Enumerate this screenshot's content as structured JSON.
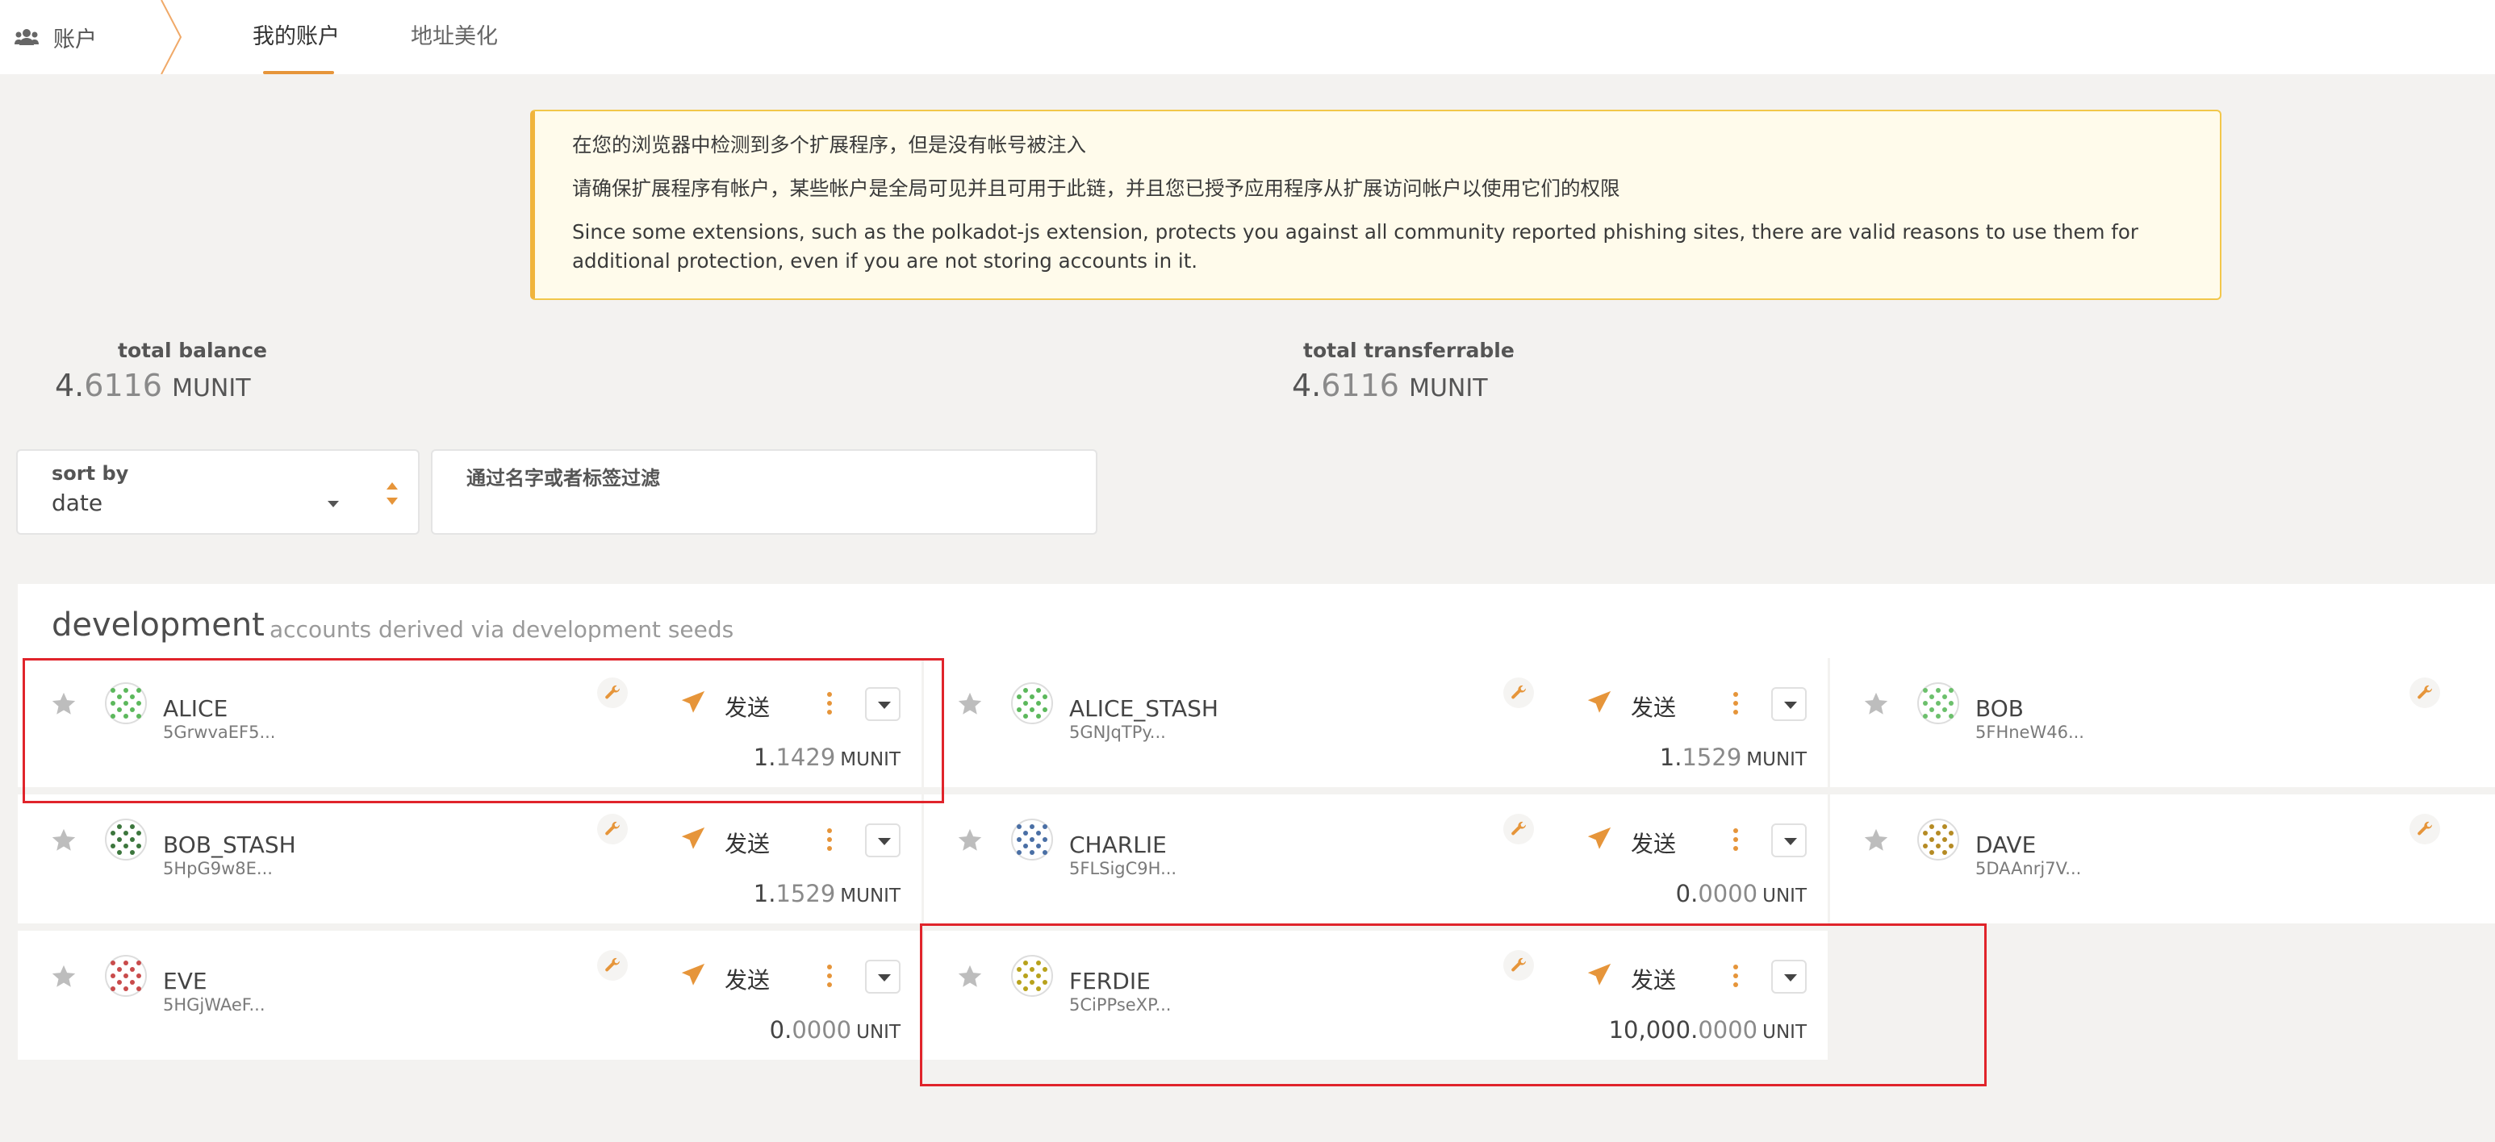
{
  "breadcrumb": {
    "label": "账户",
    "icon": "users-icon"
  },
  "tabs": [
    {
      "label": "我的账户",
      "active": true
    },
    {
      "label": "地址美化",
      "active": false
    }
  ],
  "warning": {
    "line1": "在您的浏览器中检测到多个扩展程序，但是没有帐号被注入",
    "line2": "请确保扩展程序有帐户，某些帐户是全局可见并且可用于此链，并且您已授予应用程序从扩展访问帐户以使用它们的权限",
    "line3": "Since some extensions, such as the polkadot-js extension, protects you against all community reported phishing sites, there are valid reasons to use them for additional protection, even if you are not storing accounts in it."
  },
  "summary": {
    "total_balance": {
      "label": "total balance",
      "int": "4.",
      "dec": "6116",
      "unit": "MUNIT"
    },
    "total_transferrable": {
      "label": "total transferrable",
      "int": "4.",
      "dec": "6116",
      "unit": "MUNIT"
    }
  },
  "sort": {
    "label": "sort by",
    "value": "date"
  },
  "filter": {
    "label": "通过名字或者标签过滤",
    "value": ""
  },
  "section": {
    "title": "development",
    "subtitle": "accounts derived via development seeds"
  },
  "send_label": "发送",
  "accounts": [
    {
      "name": "ALICE",
      "address": "5GrwvaEF5...",
      "int": "1.",
      "dec": "1429",
      "unit": "MUNIT"
    },
    {
      "name": "ALICE_STASH",
      "address": "5GNJqTPy...",
      "int": "1.",
      "dec": "1529",
      "unit": "MUNIT"
    },
    {
      "name": "BOB",
      "address": "5FHneW46...",
      "int": "",
      "dec": "",
      "unit": ""
    },
    {
      "name": "BOB_STASH",
      "address": "5HpG9w8E...",
      "int": "1.",
      "dec": "1529",
      "unit": "MUNIT"
    },
    {
      "name": "CHARLIE",
      "address": "5FLSigC9H...",
      "int": "0.",
      "dec": "0000",
      "unit": "UNIT"
    },
    {
      "name": "DAVE",
      "address": "5DAAnrj7V...",
      "int": "",
      "dec": "",
      "unit": ""
    },
    {
      "name": "EVE",
      "address": "5HGjWAeF...",
      "int": "0.",
      "dec": "0000",
      "unit": "UNIT"
    },
    {
      "name": "FERDIE",
      "address": "5CiPPseXP...",
      "int": "10,000.",
      "dec": "0000",
      "unit": "UNIT"
    }
  ],
  "colors": {
    "accent": "#e6953a",
    "highlight": "#e0242b",
    "warning_border": "#f2c74a"
  }
}
